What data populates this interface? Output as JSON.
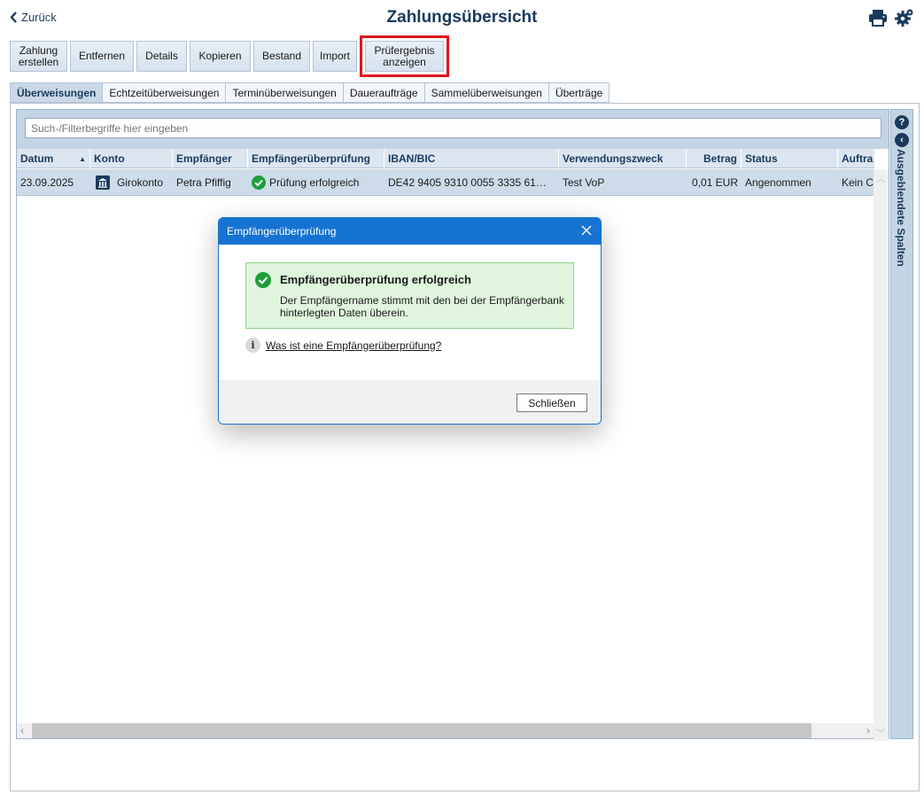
{
  "header": {
    "back_label": "Zurück",
    "title": "Zahlungsübersicht",
    "icons": [
      "print-icon",
      "settings-gear-icon"
    ]
  },
  "toolbar": {
    "buttons": [
      {
        "label_line1": "Zahlung",
        "label_line2": "erstellen"
      },
      {
        "label_line1": "Entfernen",
        "label_line2": ""
      },
      {
        "label_line1": "Details",
        "label_line2": ""
      },
      {
        "label_line1": "Kopieren",
        "label_line2": ""
      },
      {
        "label_line1": "Bestand",
        "label_line2": ""
      },
      {
        "label_line1": "Import",
        "label_line2": ""
      },
      {
        "label_line1": "Prüfergebnis",
        "label_line2": "anzeigen"
      }
    ]
  },
  "tabs": [
    {
      "label": "Überweisungen",
      "active": true
    },
    {
      "label": "Echtzeitüberweisungen",
      "active": false
    },
    {
      "label": "Terminüberweisungen",
      "active": false
    },
    {
      "label": "Daueraufträge",
      "active": false
    },
    {
      "label": "Sammelüberweisungen",
      "active": false
    },
    {
      "label": "Überträge",
      "active": false
    }
  ],
  "filter": {
    "placeholder": "Such-/Filterbegriffe hier eingeben",
    "value": ""
  },
  "table": {
    "columns": [
      "Datum",
      "Konto",
      "Empfänger",
      "Empfängerüberprüfung",
      "IBAN/BIC",
      "Verwendungszweck",
      "Betrag",
      "Status",
      "Auftra"
    ],
    "sort_indicator": "▲",
    "rows": [
      {
        "datum": "23.09.2025",
        "konto": "Girokonto",
        "empfaenger": "Petra Pfiffig",
        "pruefung": "Prüfung erfolgreich",
        "iban": "DE42 9405 9310 0055 3335 61…",
        "zweck": "Test VoP",
        "betrag": "0,01 EUR",
        "status": "Angenommen",
        "auftrag": "Kein C"
      }
    ]
  },
  "side_panel": {
    "help_symbol": "?",
    "collapse_symbol": "‹",
    "label": "Ausgeblendete Spalten"
  },
  "dialog": {
    "title": "Empfängerüberprüfung",
    "success_title": "Empfängerüberprüfung erfolgreich",
    "success_message": "Der Empfängername stimmt mit den bei der Empfängerbank hinterlegten Daten überein.",
    "info_symbol": "i",
    "info_link": "Was ist eine Empfängerüberprüfung?",
    "close_button": "Schließen"
  },
  "colors": {
    "brand_dark": "#1a3a5c",
    "dialog_header": "#1673d2",
    "success_bg": "#dff5dc",
    "success_icon": "#1e9e3a",
    "highlight": "#e0151c"
  }
}
